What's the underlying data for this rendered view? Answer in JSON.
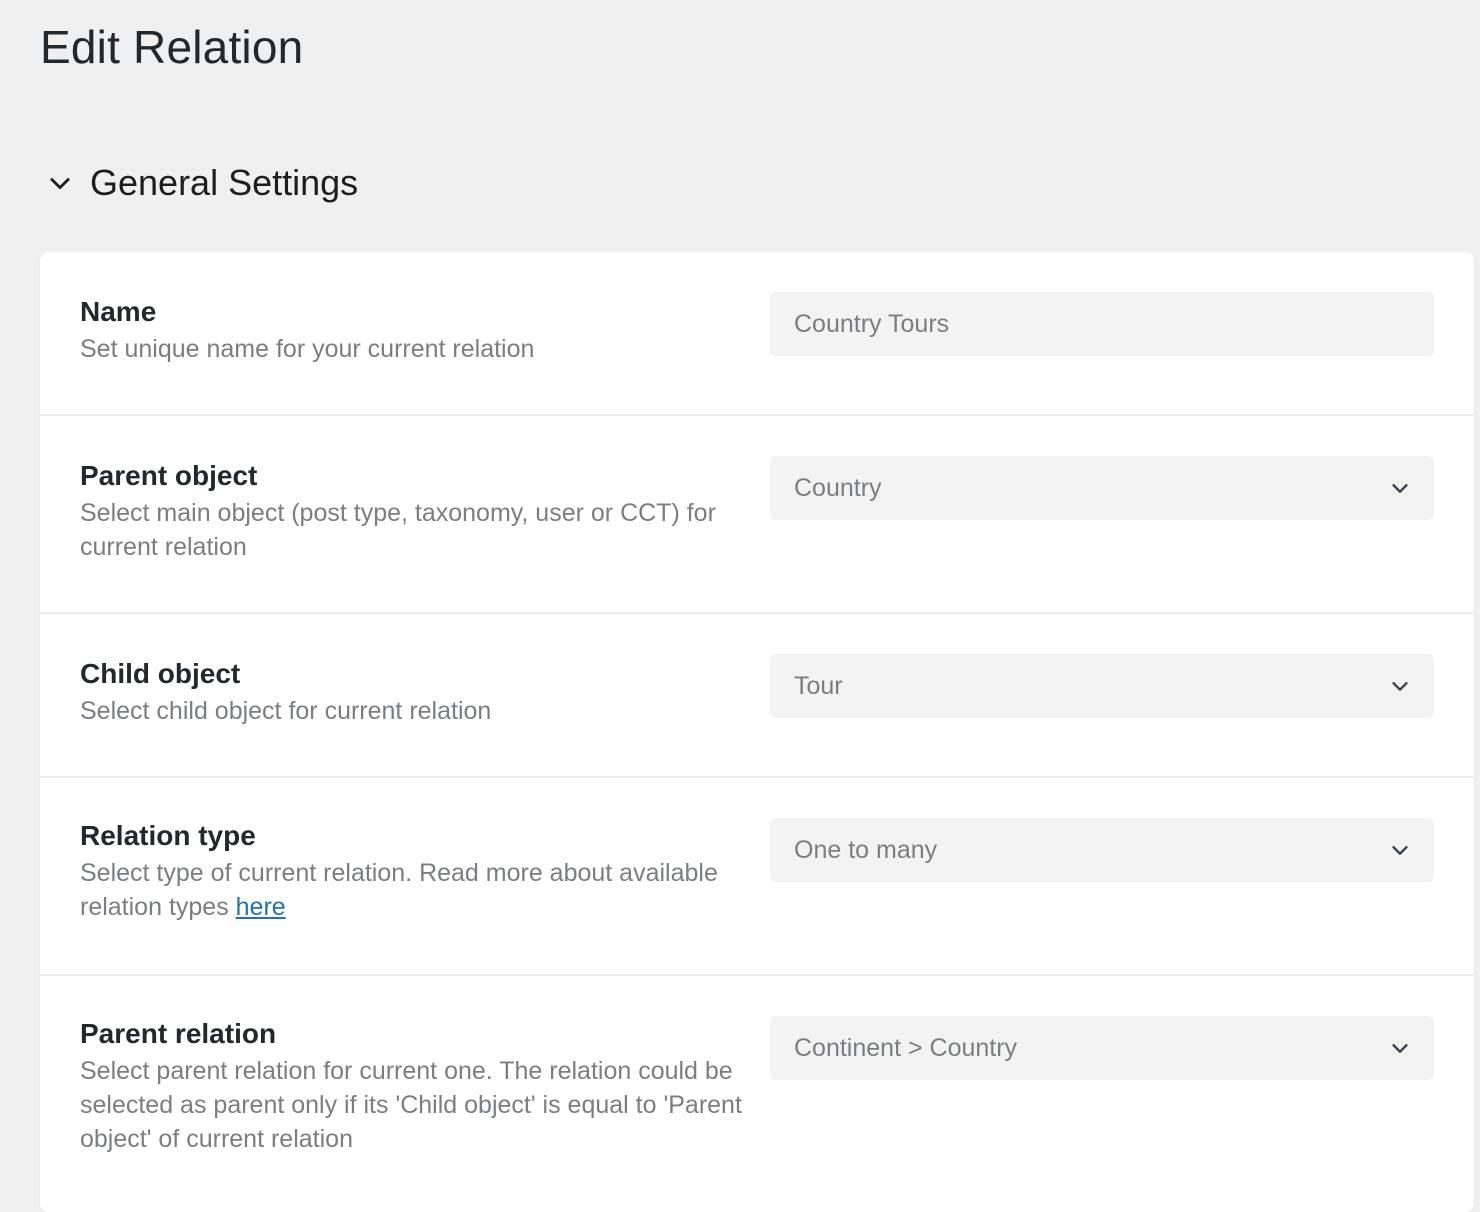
{
  "page": {
    "title": "Edit Relation"
  },
  "section": {
    "title": "General Settings",
    "icon": "chevron-down-icon"
  },
  "fields": {
    "name": {
      "label": "Name",
      "description": "Set unique name for your current relation",
      "value": "Country Tours"
    },
    "parent_object": {
      "label": "Parent object",
      "description": "Select main object (post type, taxonomy, user or CCT) for current relation",
      "value": "Country"
    },
    "child_object": {
      "label": "Child object",
      "description": "Select child object for current relation",
      "value": "Tour"
    },
    "relation_type": {
      "label": "Relation type",
      "description_before_link": "Select type of current relation. Read more about available relation types ",
      "link_text": "here",
      "value": "One to many"
    },
    "parent_relation": {
      "label": "Parent relation",
      "description": "Select parent relation for current one. The relation could be selected as parent only if its 'Child object' is equal to 'Parent object' of current relation",
      "value": "Continent > Country"
    }
  },
  "colors": {
    "background": "#f0f0f0",
    "card": "#ffffff",
    "input_background": "#f3f3f3",
    "link": "#2271b1",
    "muted_text": "#7b7e81"
  }
}
